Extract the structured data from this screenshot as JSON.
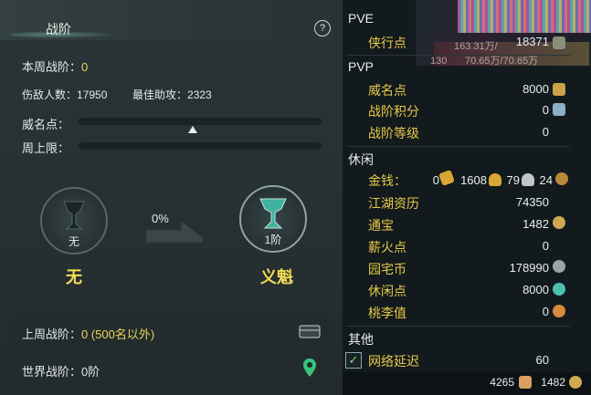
{
  "left_panel": {
    "title": "战阶",
    "help": "?",
    "weekly_rank_label": "本周战阶：",
    "weekly_rank_value": "0",
    "kills_label": "伤敌人数：",
    "kills_value": "17950",
    "best_assist_label": "最佳助攻：",
    "best_assist_value": "2323",
    "prestige_label": "威名点：",
    "weekly_limit_label": "周上限：",
    "progress_percent": "0%",
    "current_badge_caption": "无",
    "current_badge_name": "无",
    "next_badge_caption": "1阶",
    "next_badge_name": "义魁",
    "last_week_label": "上周战阶：",
    "last_week_value": "0 (500名以外)",
    "world_rank_label": "世界战阶：",
    "world_rank_value": "0阶"
  },
  "right_panel": {
    "pve": {
      "title": "PVE",
      "rows": [
        {
          "label": "侠行点",
          "value": "18371"
        }
      ]
    },
    "pvp": {
      "title": "PVP",
      "rows": [
        {
          "label": "威名点",
          "value": "8000"
        },
        {
          "label": "战阶积分",
          "value": "0"
        },
        {
          "label": "战阶等级",
          "value": "0"
        }
      ]
    },
    "leisure": {
      "title": "休闲",
      "money_label": "金钱：",
      "money_values": [
        "0",
        "1608",
        "79",
        "24"
      ],
      "rows": [
        {
          "label": "江湖资历",
          "value": "74350"
        },
        {
          "label": "通宝",
          "value": "1482"
        },
        {
          "label": "薪火点",
          "value": "0"
        },
        {
          "label": "园宅币",
          "value": "178990"
        },
        {
          "label": "休闲点",
          "value": "8000"
        },
        {
          "label": "桃李值",
          "value": "0"
        }
      ]
    },
    "other": {
      "title": "其他",
      "rows": [
        {
          "label": "网络延迟",
          "value": "60"
        }
      ]
    },
    "overlay_text_1": "163.31万/",
    "overlay_text_2": "70.65万/70.65万",
    "overlay_text_3": "130",
    "bottom_bar": {
      "left_value": "4265",
      "right_value": "1482"
    }
  }
}
